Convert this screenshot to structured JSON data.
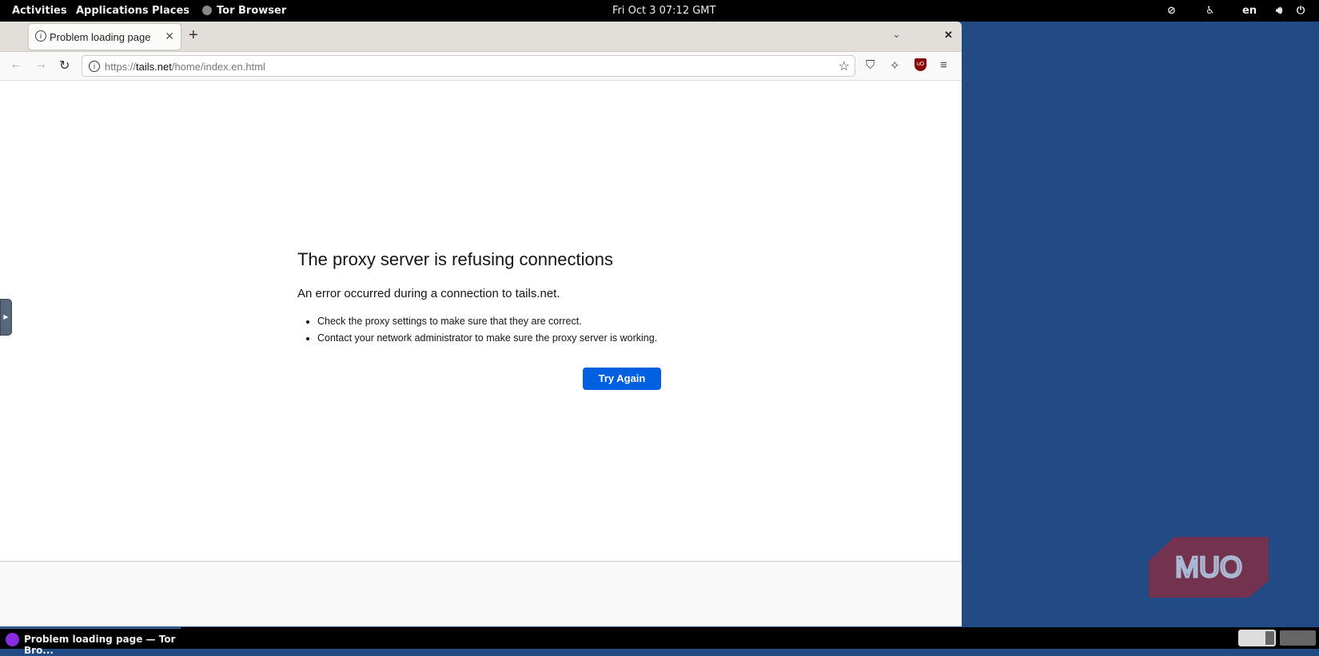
{
  "topbar": {
    "activities": "Activities",
    "applications": "Applications",
    "places": "Places",
    "app": "Tor Browser",
    "clock": "Fri Oct 3  07:12 GMT",
    "lang": "en"
  },
  "browser": {
    "tab_title": "Problem loading page",
    "url_prefix": "https://",
    "url_domain": "tails.net",
    "url_path": "/home/index.en.html"
  },
  "error": {
    "title": "The proxy server is refusing connections",
    "subtitle": "An error occurred during a connection to tails.net.",
    "bullets": [
      "Check the proxy settings to make sure that they are correct.",
      "Contact your network administrator to make sure the proxy server is working."
    ],
    "button": "Try Again"
  },
  "taskbar": {
    "task": "Problem loading page — Tor Bro..."
  },
  "watermark": "MUO"
}
